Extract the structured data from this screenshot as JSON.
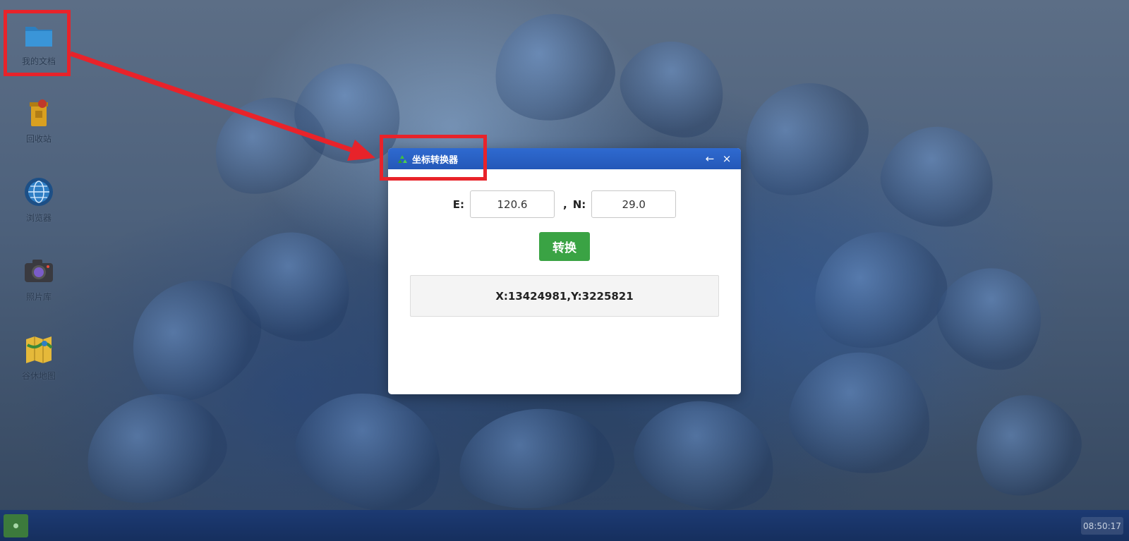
{
  "desktop": {
    "icons": [
      {
        "label": "我的文档",
        "icon": "folder-icon"
      },
      {
        "label": "回收站",
        "icon": "recycle-bin-icon"
      },
      {
        "label": "浏览器",
        "icon": "browser-globe-icon"
      },
      {
        "label": "照片库",
        "icon": "camera-icon"
      },
      {
        "label": "谷休地图",
        "icon": "map-icon"
      }
    ]
  },
  "window": {
    "title": "坐标转换器",
    "icon": "recycle-arrows-icon",
    "back_label": "←",
    "close_label": "×",
    "e_label": "E:",
    "e_value": "120.6",
    "separator": ",",
    "n_label": "N:",
    "n_value": "29.0",
    "convert_label": "转换",
    "result": "X:13424981,Y:3225821"
  },
  "taskbar": {
    "clock": "08:50:17"
  },
  "colors": {
    "titlebar": "#2a62c8",
    "convert_button": "#3aa344",
    "annotation": "#e8232a",
    "taskbar": "#1a356a"
  }
}
